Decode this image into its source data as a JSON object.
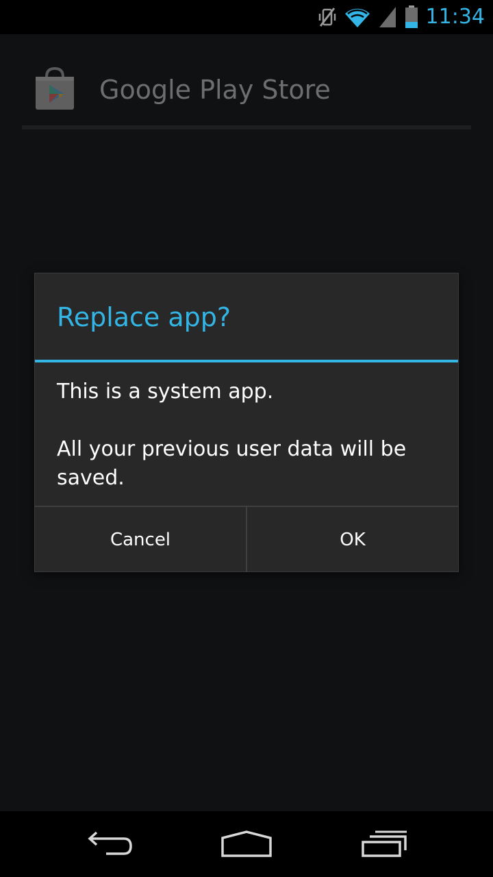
{
  "status_bar": {
    "time": "11:34",
    "icons": [
      "vibrate-off-icon",
      "wifi-icon",
      "cell-signal-icon",
      "battery-icon"
    ],
    "accent_color": "#33b5e5"
  },
  "app_bar": {
    "title": "Google Play Store",
    "icon": "play-store-icon"
  },
  "dialog": {
    "title": "Replace app?",
    "message_line1": "This is a system app.",
    "message_line2": "All your previous user data will be saved.",
    "cancel_label": "Cancel",
    "ok_label": "OK",
    "accent_color": "#33b5e5"
  },
  "nav_bar": {
    "icons": [
      "back-icon",
      "home-icon",
      "recent-apps-icon"
    ]
  }
}
